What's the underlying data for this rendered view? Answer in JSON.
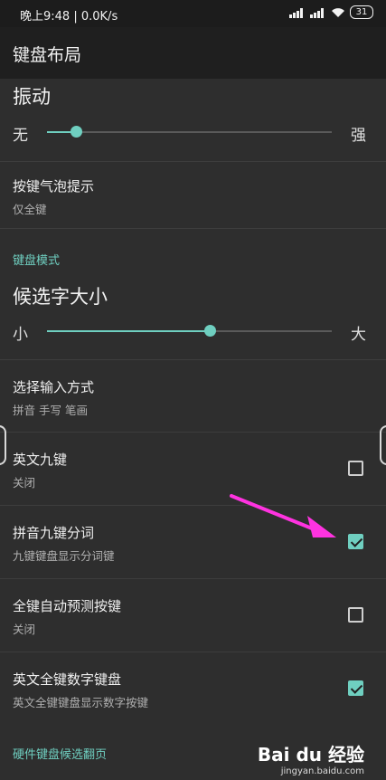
{
  "status_bar": {
    "time": "晚上9:48",
    "speed": "0.0K/s",
    "battery": "31"
  },
  "toolbar": {
    "title": "键盘布局"
  },
  "vibration": {
    "title": "振动",
    "min_label": "无",
    "max_label": "强",
    "level": 0.1
  },
  "key_popup": {
    "title": "按键气泡提示",
    "summary": "仅全键"
  },
  "keyboard_mode_section": "键盘模式",
  "candidate_size": {
    "title": "候选字大小",
    "min_label": "小",
    "max_label": "大",
    "level": 0.57
  },
  "input_method": {
    "title": "选择输入方式",
    "summary": "拼音 手写 笔画"
  },
  "english_nine_key": {
    "title": "英文九键",
    "summary": "关闭",
    "checked": false
  },
  "pinyin_nine_key_split": {
    "title": "拼音九键分词",
    "summary": "九键键盘显示分词键",
    "checked": true
  },
  "full_key_predict": {
    "title": "全键自动预测按键",
    "summary": "关闭",
    "checked": false
  },
  "english_full_number": {
    "title": "英文全键数字键盘",
    "summary": "英文全键键盘显示数字按键",
    "checked": true
  },
  "hardware_section": "硬件键盘候选翻页",
  "watermark": {
    "brand": "Bai du 经验",
    "url": "jingyan.baidu.com"
  },
  "colors": {
    "accent": "#6fcfc0",
    "background": "#2e2e2e",
    "arrow": "#ff33e0"
  }
}
